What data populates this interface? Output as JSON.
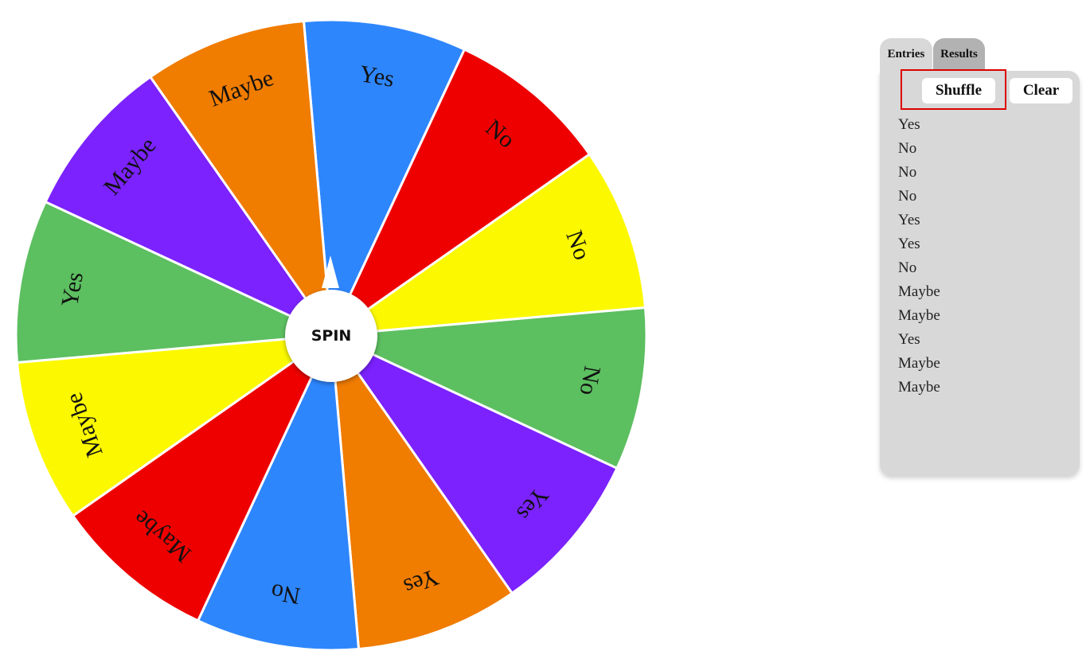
{
  "wheel": {
    "segments": [
      {
        "label": "Yes",
        "color": "#2e86fd"
      },
      {
        "label": "No",
        "color": "#ee0000"
      },
      {
        "label": "No",
        "color": "#fbf800"
      },
      {
        "label": "No",
        "color": "#5cbf60"
      },
      {
        "label": "Yes",
        "color": "#7b22fe"
      },
      {
        "label": "Yes",
        "color": "#f07c00"
      },
      {
        "label": "No",
        "color": "#2e86fd"
      },
      {
        "label": "Maybe",
        "color": "#ee0000"
      },
      {
        "label": "Maybe",
        "color": "#fbf800"
      },
      {
        "label": "Yes",
        "color": "#5cbf60"
      },
      {
        "label": "Maybe",
        "color": "#7b22fe"
      },
      {
        "label": "Maybe",
        "color": "#f07c00"
      }
    ],
    "spin_label": "SPIN"
  },
  "panel": {
    "tabs": [
      "Entries",
      "Results"
    ],
    "active_tab": "Entries",
    "shuffle_label": "Shuffle",
    "clear_label": "Clear",
    "entries": [
      "Yes",
      "No",
      "No",
      "No",
      "Yes",
      "Yes",
      "No",
      "Maybe",
      "Maybe",
      "Yes",
      "Maybe",
      "Maybe"
    ]
  }
}
